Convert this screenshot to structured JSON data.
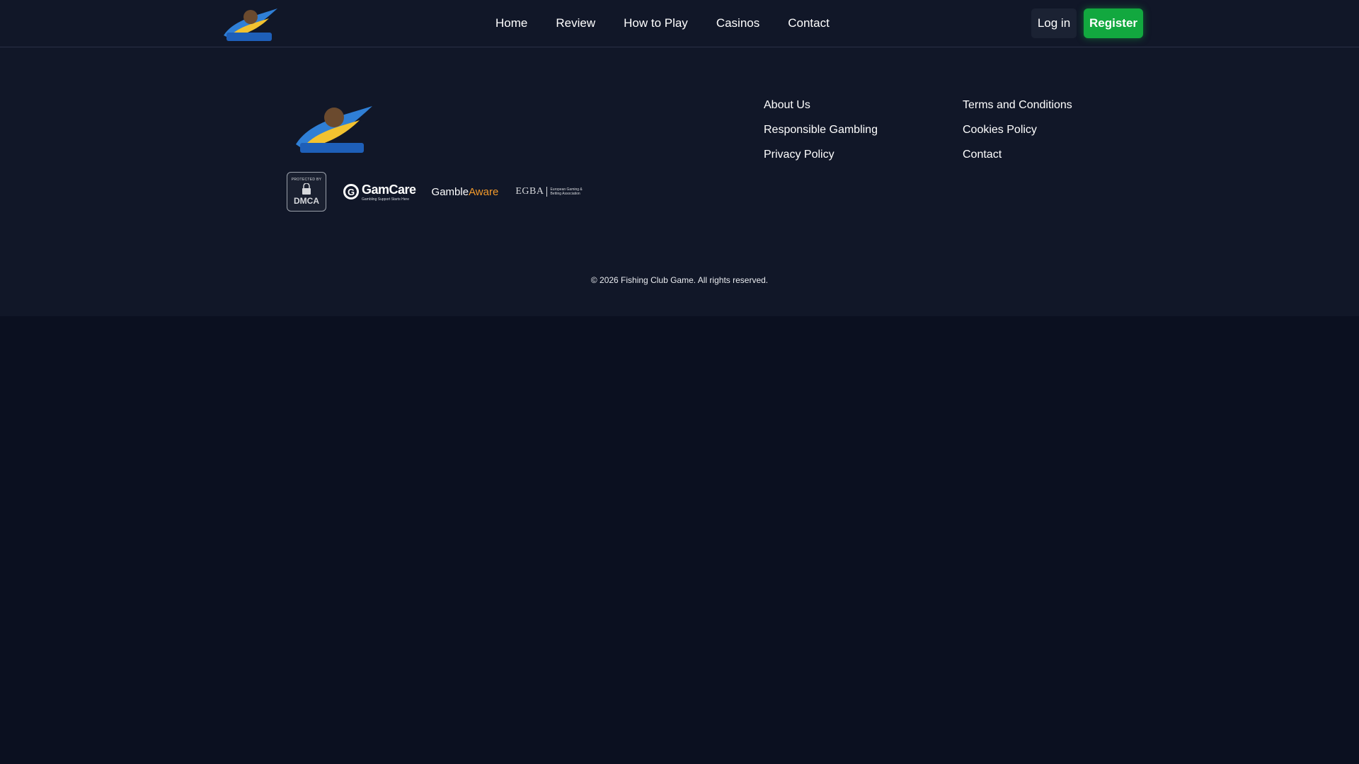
{
  "header": {
    "nav": [
      "Home",
      "Review",
      "How to Play",
      "Casinos",
      "Contact"
    ],
    "login_label": "Log in",
    "register_label": "Register"
  },
  "footer": {
    "badges": {
      "dmca_top": "PROTECTED BY",
      "dmca_main": "DMCA",
      "gamcare_name": "GamCare",
      "gamcare_sub": "Gambling Support Starts Here",
      "gambleaware_part1": "Gamble",
      "gambleaware_part2": "Aware",
      "egba_name": "EGBA",
      "egba_desc": "European Gaming & Betting Association"
    },
    "links_col1": [
      "About Us",
      "Responsible Gambling",
      "Privacy Policy"
    ],
    "links_col2": [
      "Terms and Conditions",
      "Cookies Policy",
      "Contact"
    ],
    "copyright": "© 2026 Fishing Club Game. All rights reserved."
  },
  "colors": {
    "page_bg": "#0b1020",
    "panel_bg": "#111728",
    "register_green": "#12a83f",
    "gambleaware_orange": "#f39a2b"
  }
}
